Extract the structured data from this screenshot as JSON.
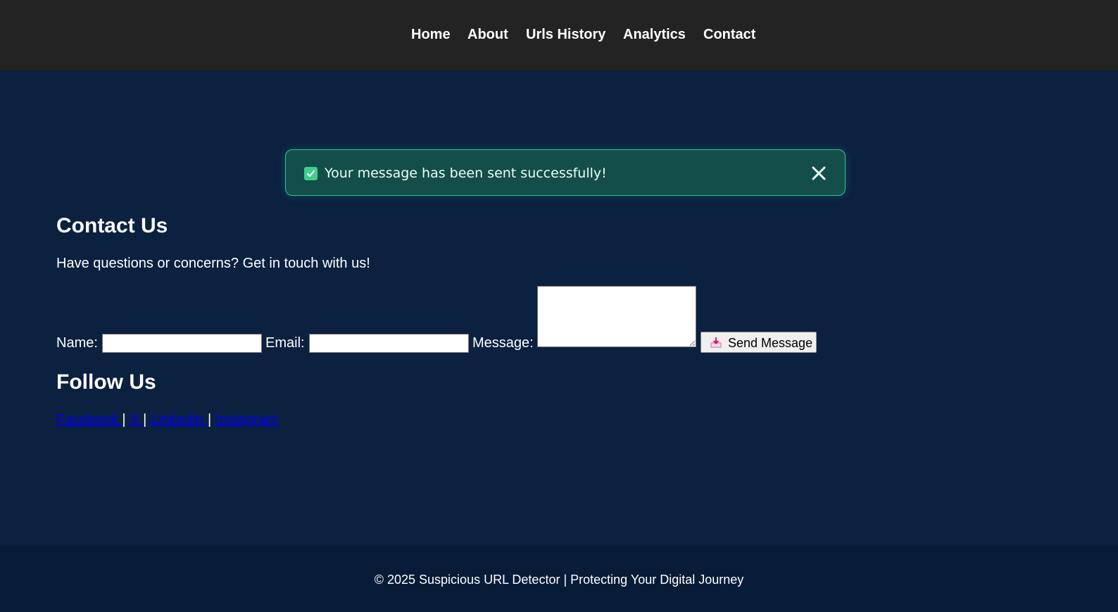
{
  "nav": {
    "items": [
      {
        "label": "Home"
      },
      {
        "label": "About"
      },
      {
        "label": "Urls History"
      },
      {
        "label": "Analytics"
      },
      {
        "label": "Contact"
      }
    ]
  },
  "alert": {
    "message": "Your message has been sent successfully!",
    "icon": "check-icon",
    "close_icon": "close-icon",
    "accent_color": "#2fc497"
  },
  "contact": {
    "title": "Contact Us",
    "intro": "Have questions or concerns? Get in touch with us!",
    "form": {
      "name_label": "Name:",
      "name_value": "",
      "email_label": "Email:",
      "email_value": "",
      "message_label": "Message:",
      "message_value": "",
      "submit_label": "Send Message",
      "submit_icon": "inbox-tray-icon"
    }
  },
  "follow": {
    "title": "Follow Us",
    "links": [
      {
        "label": "Facebook "
      },
      {
        "label": "X "
      },
      {
        "label": "LinkedIn "
      },
      {
        "label": "Instagram"
      }
    ],
    "separator": "|"
  },
  "footer": {
    "text": "© 2025 Suspicious URL Detector | Protecting Your Digital Journey"
  },
  "colors": {
    "nav_bg": "#232323",
    "page_bg": "#0c2040",
    "footer_bg": "#081b37",
    "alert_bg": "#144e4a",
    "link": "#0000ee"
  }
}
